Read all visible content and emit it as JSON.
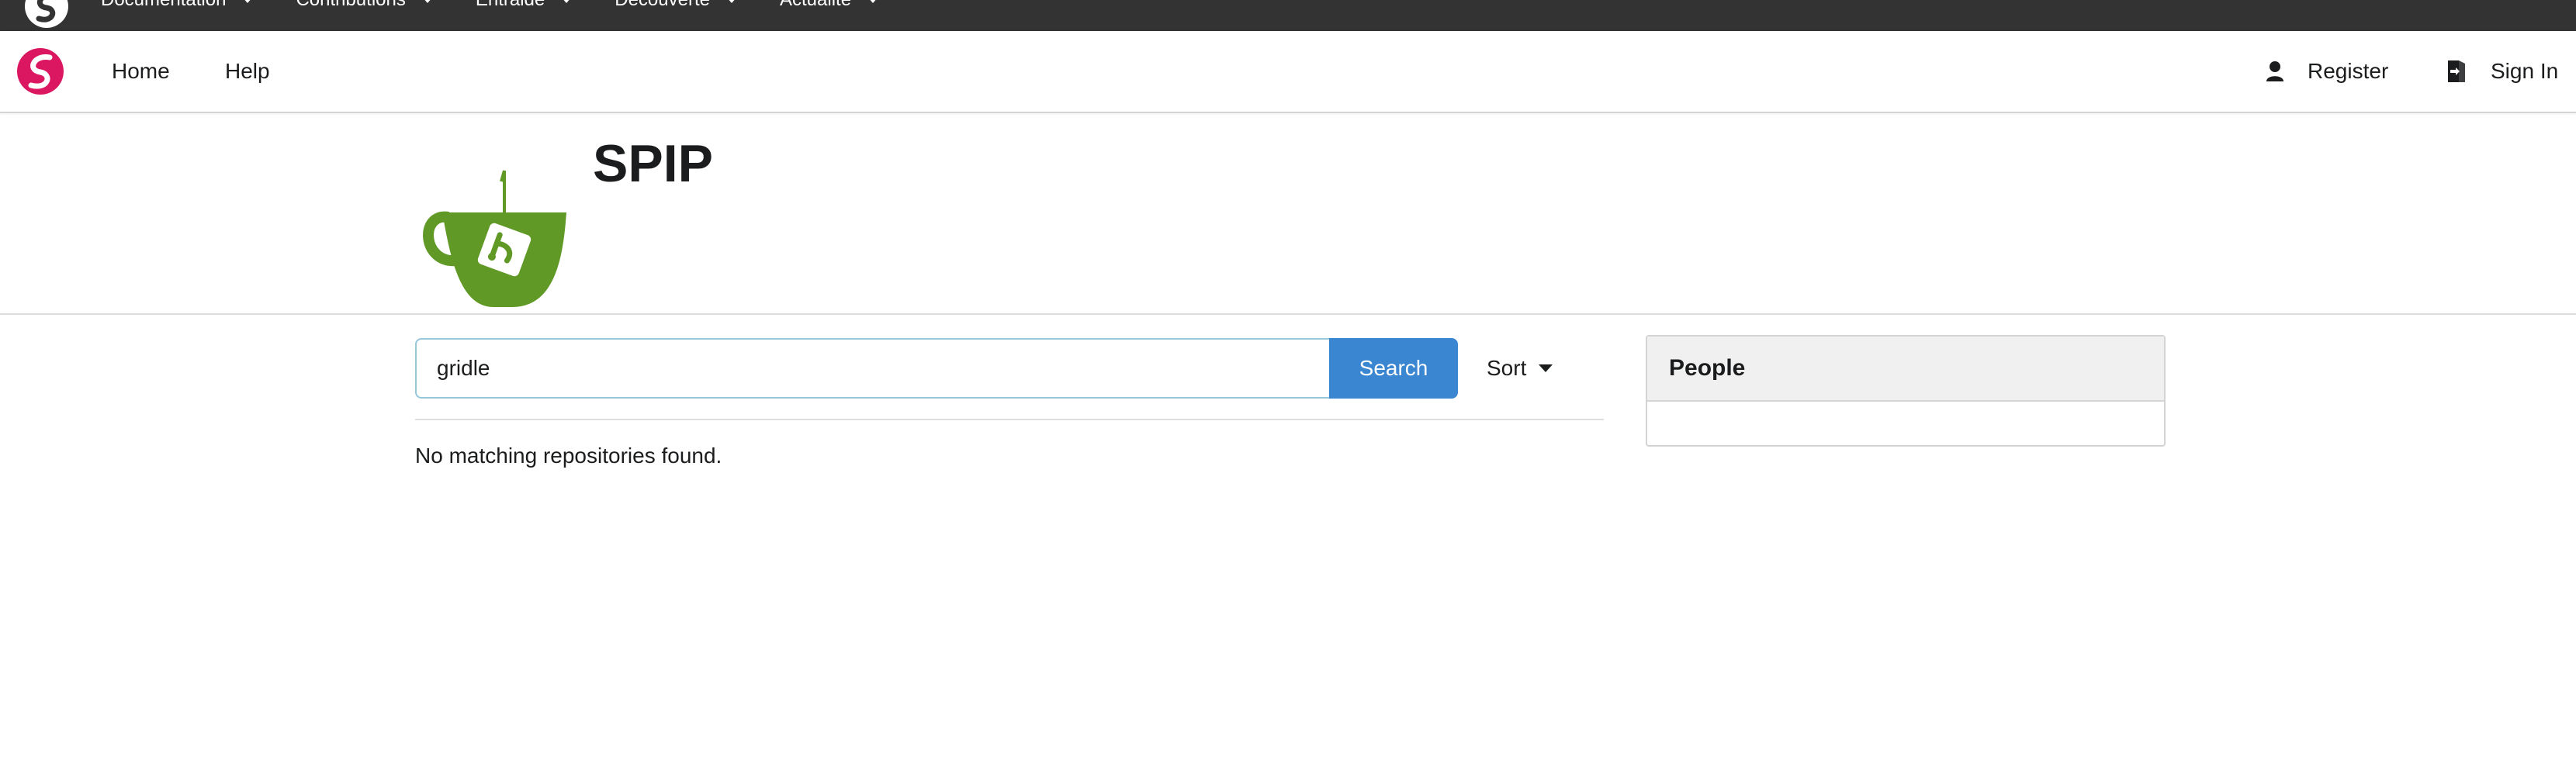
{
  "topbar": {
    "logo_icon": "spip-swirl-icon",
    "menu": [
      {
        "label": "Documentation"
      },
      {
        "label": "Contributions"
      },
      {
        "label": "Entraide"
      },
      {
        "label": "Découverte"
      },
      {
        "label": "Actualité"
      }
    ]
  },
  "navbar": {
    "logo_icon": "spip-logo-icon",
    "home_label": "Home",
    "help_label": "Help",
    "register_label": "Register",
    "register_icon": "user-icon",
    "signin_label": "Sign In",
    "signin_icon": "sign-in-icon"
  },
  "header": {
    "avatar_icon": "gitea-teacup-icon",
    "title": "SPIP"
  },
  "search": {
    "value": "gridle",
    "button_label": "Search",
    "sort_label": "Sort"
  },
  "results": {
    "empty_message": "No matching repositories found."
  },
  "people": {
    "title": "People"
  },
  "colors": {
    "topbar_bg": "#333333",
    "search_button": "#3a86d0",
    "gitea_green": "#609926",
    "spip_pink": "#db1762"
  }
}
